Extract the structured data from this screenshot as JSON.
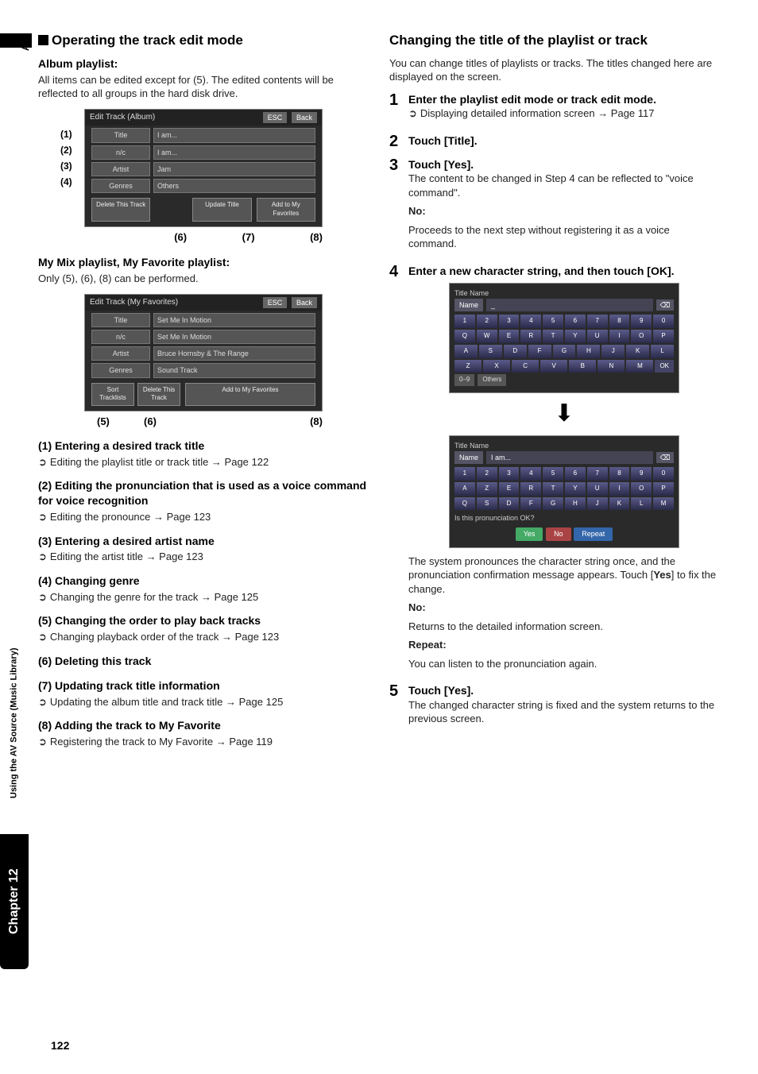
{
  "page_number": "122",
  "sidebar": {
    "av": "AV",
    "chapter": "Chapter 12",
    "subtitle": "Using the AV Source (Music Library)"
  },
  "left": {
    "section_title": "Operating the track edit mode",
    "album_playlist_head": "Album playlist:",
    "album_playlist_body": "All items can be edited except for (5). The edited contents will be reflected to all groups in the hard disk drive.",
    "fig1": {
      "titlebar": "Edit Track (Album)",
      "esc": "ESC",
      "back": "Back",
      "rows": [
        {
          "label": "Title",
          "value": "I am..."
        },
        {
          "label": "n/c",
          "value": "I am..."
        },
        {
          "label": "Artist",
          "value": "Jam"
        },
        {
          "label": "Genres",
          "value": "Others"
        }
      ],
      "btns": [
        "Delete This Track",
        "Update Title",
        "Add to My Favorites"
      ],
      "callouts_left": [
        "(1)",
        "(2)",
        "(3)",
        "(4)"
      ],
      "callouts_bottom": [
        "(6)",
        "(7)",
        "(8)"
      ]
    },
    "mix_head": "My Mix playlist, My Favorite playlist:",
    "mix_body": "Only (5), (6), (8) can be performed.",
    "fig2": {
      "titlebar": "Edit Track (My Favorites)",
      "esc": "ESC",
      "back": "Back",
      "rows": [
        {
          "label": "Title",
          "value": "Set Me In Motion"
        },
        {
          "label": "n/c",
          "value": "Set Me In Motion"
        },
        {
          "label": "Artist",
          "value": "Bruce Hornsby & The Range"
        },
        {
          "label": "Genres",
          "value": "Sound Track"
        }
      ],
      "btns_left": [
        "Sort Tracklists",
        "Delete This Track"
      ],
      "btns_right": [
        "Add to My Favorites"
      ],
      "callouts_bottom": [
        "(5)",
        "(6)",
        "(8)"
      ]
    },
    "items": [
      {
        "head": "(1) Entering a desired track title",
        "body": "Editing the playlist title or track title → Page 122"
      },
      {
        "head": "(2) Editing the pronunciation that is used as a voice command for voice recognition",
        "body": "Editing the pronounce → Page 123"
      },
      {
        "head": "(3) Entering a desired artist name",
        "body": "Editing the artist title → Page 123"
      },
      {
        "head": "(4) Changing genre",
        "body": "Changing the genre for the track → Page 125"
      },
      {
        "head": "(5) Changing the order to play back tracks",
        "body": "Changing playback order of the track → Page 123"
      },
      {
        "head": "(6) Deleting this track",
        "body": ""
      },
      {
        "head": "(7) Updating track title information",
        "body": "Updating the album title and track title → Page 125"
      },
      {
        "head": "(8) Adding the track to My Favorite",
        "body": "Registering the track to My Favorite → Page 119"
      }
    ]
  },
  "right": {
    "section_title": "Changing the title of the playlist or track",
    "intro": "You can change titles of playlists or tracks. The titles changed here are displayed on the screen.",
    "step1_head": "Enter the playlist edit mode or track edit mode.",
    "step1_body": "Displaying detailed information screen → Page 117",
    "step2_head": "Touch [Title].",
    "step3_head": "Touch [Yes].",
    "step3_body1": "The content to be changed in Step 4 can be reflected to \"voice command\".",
    "step3_no_label": "No:",
    "step3_no_body": "Proceeds to the next step without registering it as a voice command.",
    "step4_head": "Enter a new character string, and then touch [OK].",
    "kb1": {
      "title": "Title Name",
      "name_label": "Name",
      "name_value": "_",
      "rows": [
        [
          "1",
          "2",
          "3",
          "4",
          "5",
          "6",
          "7",
          "8",
          "9",
          "0"
        ],
        [
          "Q",
          "W",
          "E",
          "R",
          "T",
          "Y",
          "U",
          "I",
          "O",
          "P"
        ],
        [
          "A",
          "S",
          "D",
          "F",
          "G",
          "H",
          "J",
          "K",
          "L"
        ],
        [
          "Z",
          "X",
          "C",
          "V",
          "B",
          "N",
          "M"
        ]
      ],
      "ok": "OK",
      "foot": [
        "0–9",
        "Others"
      ]
    },
    "kb2": {
      "title": "Title Name",
      "name_label": "Name",
      "name_value": "I am...",
      "rows": [
        [
          "1",
          "2",
          "3",
          "4",
          "5",
          "6",
          "7",
          "8",
          "9",
          "0"
        ],
        [
          "A",
          "Z",
          "E",
          "R",
          "T",
          "Y",
          "U",
          "I",
          "O",
          "P"
        ],
        [
          "Q",
          "S",
          "D",
          "F",
          "G",
          "H",
          "J",
          "K",
          "L",
          "M"
        ]
      ],
      "confirm_text": "Is this pronunciation OK?",
      "buttons": [
        "Yes",
        "No",
        "Repeat"
      ]
    },
    "step4_body1": "The system pronounces the character string once, and the pronunciation confirmation message appears. Touch [Yes] to fix the change.",
    "step4_no_label": "No:",
    "step4_no_body": "Returns to the detailed information screen.",
    "step4_repeat_label": "Repeat:",
    "step4_repeat_body": "You can listen to the pronunciation again.",
    "step5_head": "Touch [Yes].",
    "step5_body": "The changed character string is fixed and the system returns to the previous screen."
  }
}
